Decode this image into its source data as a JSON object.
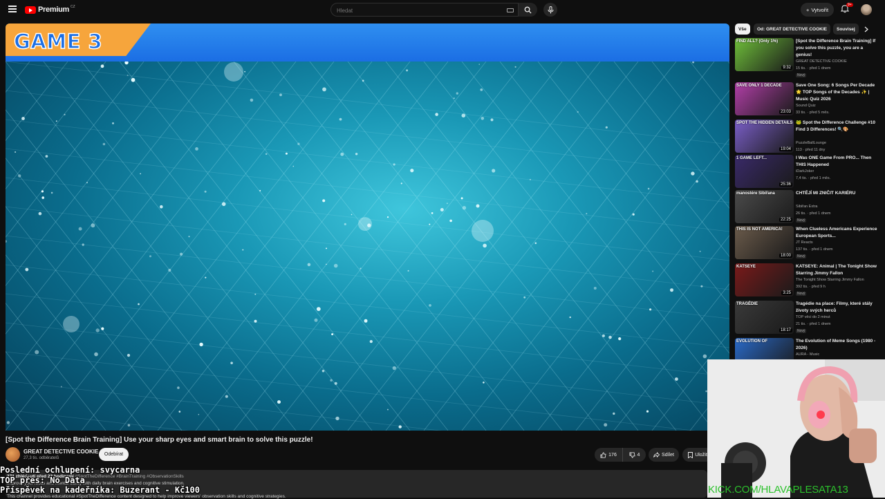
{
  "header": {
    "logo_text": "Premium",
    "logo_country": "CZ",
    "search_placeholder": "Hledat",
    "create_label": "Vytvořit",
    "notifications_badge": "9+"
  },
  "video": {
    "overlay_label": "GAME 3",
    "title": "[Spot the Difference Brain Training] Use your sharp eyes and smart brain to solve this puzzle!",
    "channel_name": "GREAT DETECTIVE COOKIE",
    "channel_subs": "27,3 tis. odběratelů",
    "subscribe_label": "Odebírat",
    "likes": "176",
    "dislikes": "4",
    "share_label": "Sdílet",
    "save_label": "Uložit",
    "views": "271 zhlédnutí",
    "age": "před 23 hodinami",
    "hashtags": "#SpotTheDifference #BrainTraining #ObservationSkills",
    "desc_line1": "Improve your focus and mental clarity with daily brain exercises and cognitive stimulation.",
    "desc_line2": "This channel provides educational #SpotTheDifference content designed to help improve viewers' observation skills and cognitive strategies."
  },
  "stream_overlay": {
    "line1": "Poslední ochlupení: svycarna",
    "line2": "TOP přes: No Data",
    "line3": "Příspěvek na kadeřníka: Buzerant - Kč100",
    "webcam_caption": "KICK.COM/HLAVAPLESATA13"
  },
  "chips": [
    "Vše",
    "Od: GREAT DETECTIVE COOKIE",
    "Souvisej"
  ],
  "recommendations": [
    {
      "title": "[Spot the Difference Brain Training] If you solve this puzzle, you are a genius!",
      "channel": "GREAT DETECTIVE COOKIE",
      "views": "15 tis.",
      "age": "před 1 dnem",
      "badge": "Nový",
      "duration": "9:32",
      "thumb_text": "FIND ALL? (Only 1%)",
      "thumb_color": "#6fbf3a"
    },
    {
      "title": "Save One Song: 6 Songs Per Decade 🌟 TOP Songs of the Decades ✨ | Music Quiz 2026",
      "channel": "Sound Quiz",
      "views": "33 tis.",
      "age": "před 5 měs.",
      "badge": "",
      "duration": "23:03",
      "thumb_text": "SAVE ONLY 1 DECADE",
      "thumb_color": "#b23fa8"
    },
    {
      "title": "🐸 Spot the Difference Challenge #10 Find 3 Differences! 🔍🎨",
      "channel": "PuzzleBallLounge",
      "views": "113",
      "age": "před 11 dny",
      "badge": "",
      "duration": "19:04",
      "thumb_text": "SPOT THE HIDDEN DETAILS",
      "thumb_color": "#7b5fc9"
    },
    {
      "title": "I Was ONE Game From PRO... Then THIS Happened",
      "channel": "iDarkJoker",
      "views": "7,4 tis.",
      "age": "před 1 měs.",
      "badge": "",
      "duration": "25:36",
      "thumb_text": "1 GAME LEFT...",
      "thumb_color": "#3a2a6a"
    },
    {
      "title": "CHTĚJÍ MI ZNIČIT KARIÉRU",
      "channel": "Sibiřan Extra",
      "views": "26 tis.",
      "age": "před 1 dnem",
      "badge": "Nový",
      "duration": "22:25",
      "thumb_text": "manostére Sibiřana",
      "thumb_color": "#4b4b4b"
    },
    {
      "title": "When Clueless Americans Experience European Sports...",
      "channel": "JT Reacts",
      "views": "137 tis.",
      "age": "před 1 dnem",
      "badge": "Nový",
      "duration": "18:00",
      "thumb_text": "THIS IS NOT AMERICA!",
      "thumb_color": "#6b5b4b"
    },
    {
      "title": "KATSEYE: Animal | The Tonight Show Starring Jimmy Fallon",
      "channel": "The Tonight Show Starring Jimmy Fallon",
      "views": "392 tis.",
      "age": "před 9 h",
      "badge": "Nový",
      "duration": "3:25",
      "thumb_text": "KATSEYE",
      "thumb_color": "#7a1a1a"
    },
    {
      "title": "Tragédie na place: Filmy, které stály životy svých herců",
      "channel": "TOP věci do 2 minut",
      "views": "21 tis.",
      "age": "před 1 dnem",
      "badge": "Nový",
      "duration": "18:17",
      "thumb_text": "TRAGÉDIE",
      "thumb_color": "#3a3a3a"
    },
    {
      "title": "The Evolution of Meme Songs (1980 - 2026)",
      "channel": "AURA - Music",
      "views": "",
      "age": "",
      "badge": "",
      "duration": "",
      "thumb_text": "EVOLUTION OF",
      "thumb_color": "#2a6ac9"
    }
  ],
  "colors": {
    "background": "#0f0f0f",
    "accent_red": "#ff0000",
    "game_bar_blue": "#1b6ee4",
    "game_badge_orange": "#f6a53c",
    "kick_green": "#2cc12c"
  }
}
